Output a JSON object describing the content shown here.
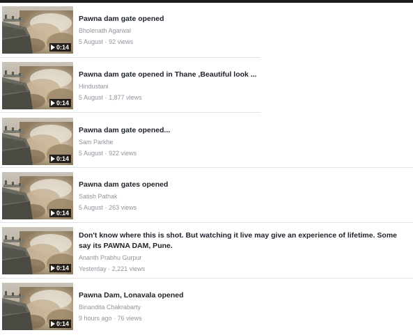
{
  "videos": [
    {
      "title": "Pawna dam gate opened",
      "author": "Bholenath Agarwal",
      "date": "5 August",
      "sep": "·",
      "views": "92 views",
      "duration": "0:14"
    },
    {
      "title": "Pawna dam gate opened in Thane ,Beautiful look ...",
      "author": "Hindustani",
      "date": "5 August",
      "sep": "·",
      "views": "1,877 views",
      "duration": "0:14"
    },
    {
      "title": "Pawna dam gate opened...",
      "author": "Sam Parkhe",
      "date": "5 August",
      "sep": "·",
      "views": "922 views",
      "duration": "0:14"
    },
    {
      "title": "Pawna dam gates opened",
      "author": "Satish Pathak",
      "date": "5 August",
      "sep": "·",
      "views": "263 views",
      "duration": "0:14"
    },
    {
      "title": "Don't know where this is shot. But watching it live may give an experience of lifetime. Some say its PAWNA DAM, Pune.",
      "author": "Ananth Prabhu Gurpur",
      "date": "Yesterday",
      "sep": "·",
      "views": "2,221 views",
      "duration": "0:14"
    },
    {
      "title": "Pawna Dam, Lonavala opened",
      "author": "Binandita Chakrabarty",
      "date": "9 hours ago",
      "sep": "·",
      "views": "76 views",
      "duration": "0:14"
    }
  ]
}
